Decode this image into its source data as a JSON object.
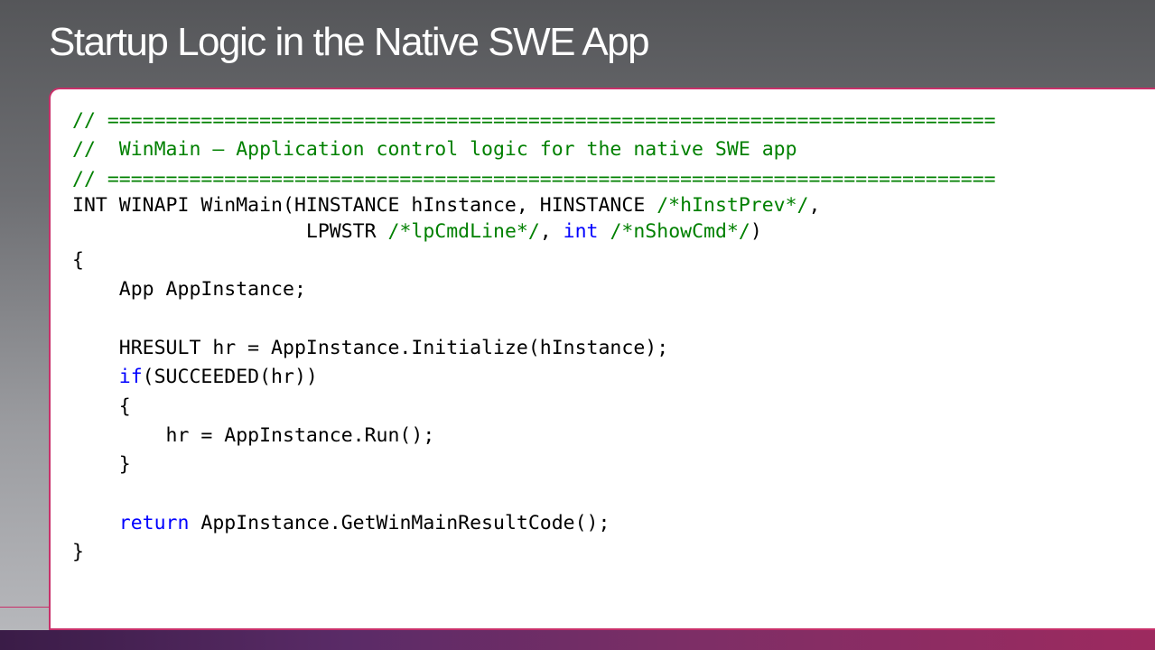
{
  "slide": {
    "title": "Startup Logic in the Native SWE App"
  },
  "code": {
    "lines": [
      [
        {
          "t": "// ============================================================================",
          "c": "cmt"
        }
      ],
      [
        {
          "t": "//  WinMain – Application control logic for the native SWE app",
          "c": "cmt"
        }
      ],
      [
        {
          "t": "// ============================================================================",
          "c": "cmt"
        }
      ],
      [
        {
          "t": "INT WINAPI WinMain(HINSTANCE hInstance, HINSTANCE ",
          "c": "plain"
        },
        {
          "t": "/*hInstPrev*/",
          "c": "cmt"
        },
        {
          "t": ",",
          "c": "plain"
        }
      ],
      [
        {
          "t": "                    LPWSTR ",
          "c": "plain"
        },
        {
          "t": "/*lpCmdLine*/",
          "c": "cmt"
        },
        {
          "t": ", ",
          "c": "plain"
        },
        {
          "t": "int",
          "c": "kw"
        },
        {
          "t": " ",
          "c": "plain"
        },
        {
          "t": "/*nShowCmd*/",
          "c": "cmt"
        },
        {
          "t": ")",
          "c": "plain"
        }
      ],
      [
        {
          "t": "{",
          "c": "plain"
        }
      ],
      [
        {
          "t": "    App AppInstance;",
          "c": "plain"
        }
      ],
      [],
      [
        {
          "t": "    HRESULT hr = AppInstance.Initialize(hInstance);",
          "c": "plain"
        }
      ],
      [
        {
          "t": "    ",
          "c": "plain"
        },
        {
          "t": "if",
          "c": "kw"
        },
        {
          "t": "(SUCCEEDED(hr))",
          "c": "plain"
        }
      ],
      [
        {
          "t": "    {",
          "c": "plain"
        }
      ],
      [
        {
          "t": "        hr = AppInstance.Run();",
          "c": "plain"
        }
      ],
      [
        {
          "t": "    }",
          "c": "plain"
        }
      ],
      [],
      [
        {
          "t": "    ",
          "c": "plain"
        },
        {
          "t": "return",
          "c": "kw"
        },
        {
          "t": " AppInstance.GetWinMainResultCode();",
          "c": "plain"
        }
      ],
      [
        {
          "t": "}",
          "c": "plain"
        }
      ]
    ]
  },
  "colors": {
    "comment": "#008000",
    "keyword": "#0000ff",
    "accent": "#c8306a",
    "title": "#ffffff"
  }
}
